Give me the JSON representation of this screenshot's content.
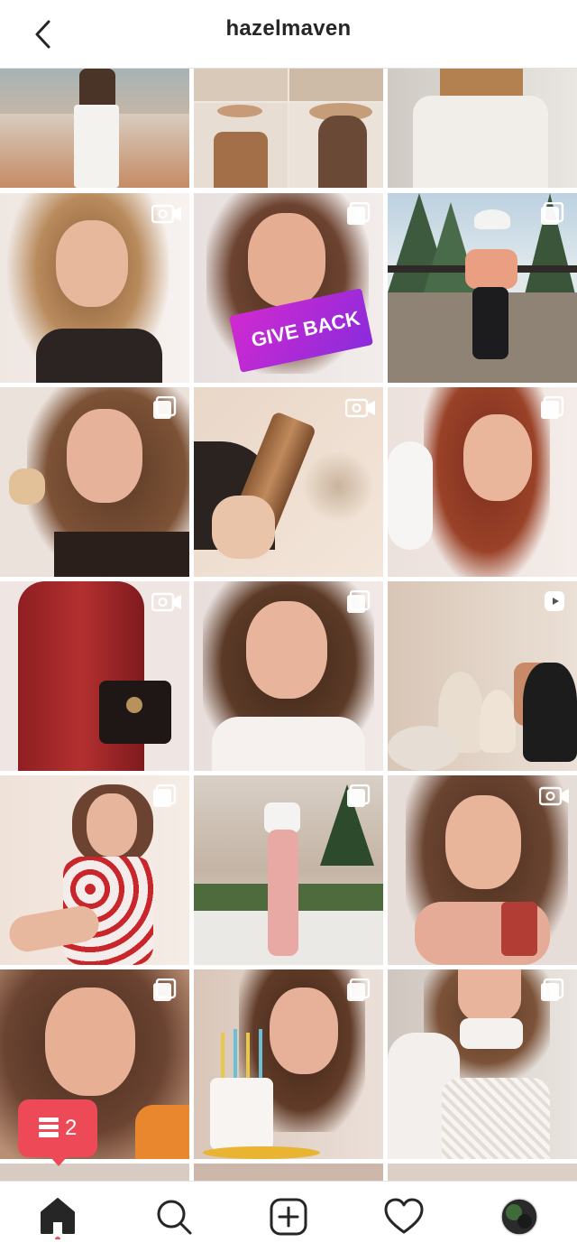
{
  "header": {
    "title": "hazelmaven",
    "back_icon": "chevron-left-icon"
  },
  "grid": {
    "posts": [
      {
        "id": "post-row0-col0",
        "badge": "none"
      },
      {
        "id": "post-row0-col1",
        "badge": "none"
      },
      {
        "id": "post-row0-col2",
        "badge": "none"
      },
      {
        "id": "post-row1-col0",
        "badge": "video"
      },
      {
        "id": "post-row1-col1",
        "badge": "carousel",
        "caption_text": "GIVE BACK"
      },
      {
        "id": "post-row1-col2",
        "badge": "carousel"
      },
      {
        "id": "post-row2-col0",
        "badge": "carousel"
      },
      {
        "id": "post-row2-col1",
        "badge": "video"
      },
      {
        "id": "post-row2-col2",
        "badge": "carousel"
      },
      {
        "id": "post-row3-col0",
        "badge": "video"
      },
      {
        "id": "post-row3-col1",
        "badge": "carousel"
      },
      {
        "id": "post-row3-col2",
        "badge": "reel"
      },
      {
        "id": "post-row4-col0",
        "badge": "carousel"
      },
      {
        "id": "post-row4-col1",
        "badge": "carousel"
      },
      {
        "id": "post-row4-col2",
        "badge": "video"
      },
      {
        "id": "post-row5-col0",
        "badge": "carousel"
      },
      {
        "id": "post-row5-col1",
        "badge": "carousel"
      },
      {
        "id": "post-row5-col2",
        "badge": "carousel"
      }
    ]
  },
  "notification": {
    "count": "2",
    "icon": "activity-list-icon",
    "color": "#ed4956"
  },
  "bottom_nav": {
    "items": [
      {
        "name": "home",
        "icon": "home-icon",
        "active": true
      },
      {
        "name": "search",
        "icon": "search-icon"
      },
      {
        "name": "create",
        "icon": "add-post-icon"
      },
      {
        "name": "activity",
        "icon": "heart-icon"
      },
      {
        "name": "profile",
        "icon": "avatar-icon"
      }
    ],
    "active_dot_color": "#ed4956"
  }
}
